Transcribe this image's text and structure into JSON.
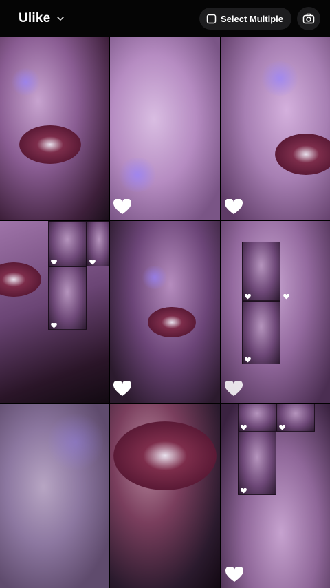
{
  "header": {
    "app_name": "Ulike",
    "select_multiple_label": "Select Multiple"
  },
  "colors": {
    "background": "#000000",
    "button_bg": "#1d1d1f",
    "heart": "#ffffff"
  },
  "icons": {
    "dropdown": "chevron-down-icon",
    "select": "square-select-icon",
    "camera": "camera-icon",
    "favorite": "heart-icon"
  },
  "gallery": {
    "photos": [
      {
        "favorited": false
      },
      {
        "favorited": true
      },
      {
        "favorited": true
      },
      {
        "favorited": false
      },
      {
        "favorited": true
      },
      {
        "favorited": true
      },
      {
        "favorited": false
      },
      {
        "favorited": false
      },
      {
        "favorited": true
      }
    ]
  }
}
